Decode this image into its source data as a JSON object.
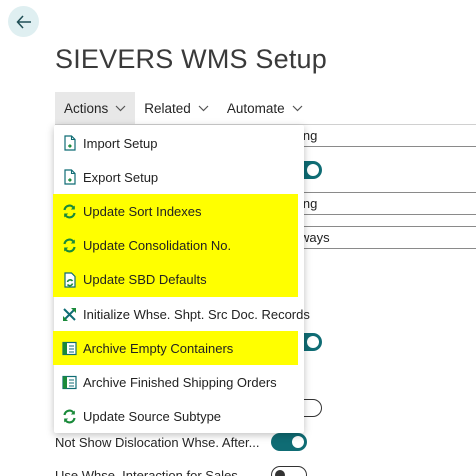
{
  "page": {
    "title": "SIEVERS WMS Setup"
  },
  "menubar": {
    "tabs": [
      {
        "label": "Actions"
      },
      {
        "label": "Related"
      },
      {
        "label": "Automate"
      }
    ]
  },
  "background_form": {
    "fields": [
      {
        "value_partial": "ing"
      },
      {
        "value_partial": "ing"
      },
      {
        "value_partial": "ways"
      }
    ],
    "rows": [
      {
        "label": "Not Show Dislocation Whse. After...",
        "toggle": "on"
      },
      {
        "label": "Use Whse. Interaction for Sales...",
        "toggle": "off"
      }
    ]
  },
  "actions_menu": {
    "items": [
      {
        "label": "Import Setup",
        "icon": "import-document-icon",
        "highlighted": false
      },
      {
        "label": "Export Setup",
        "icon": "export-document-icon",
        "highlighted": false
      },
      {
        "label": "Update Sort Indexes",
        "icon": "refresh-icon",
        "highlighted": true
      },
      {
        "label": "Update Consolidation No.",
        "icon": "refresh-icon",
        "highlighted": true
      },
      {
        "label": "Update SBD Defaults",
        "icon": "refresh-document-icon",
        "highlighted": true
      },
      {
        "label": "Initialize Whse. Shpt. Src Doc. Records",
        "icon": "initialize-icon",
        "highlighted": false
      },
      {
        "label": "Archive Empty Containers",
        "icon": "archive-icon",
        "highlighted": true
      },
      {
        "label": "Archive Finished Shipping Orders",
        "icon": "archive-icon",
        "highlighted": false
      },
      {
        "label": "Update Source Subtype",
        "icon": "refresh-icon",
        "highlighted": false
      }
    ]
  },
  "colors": {
    "accent": "#0f6c74",
    "highlight": "#ffff00",
    "back_button_bg": "#dfeff1",
    "icon_green": "#1a8a3a"
  }
}
